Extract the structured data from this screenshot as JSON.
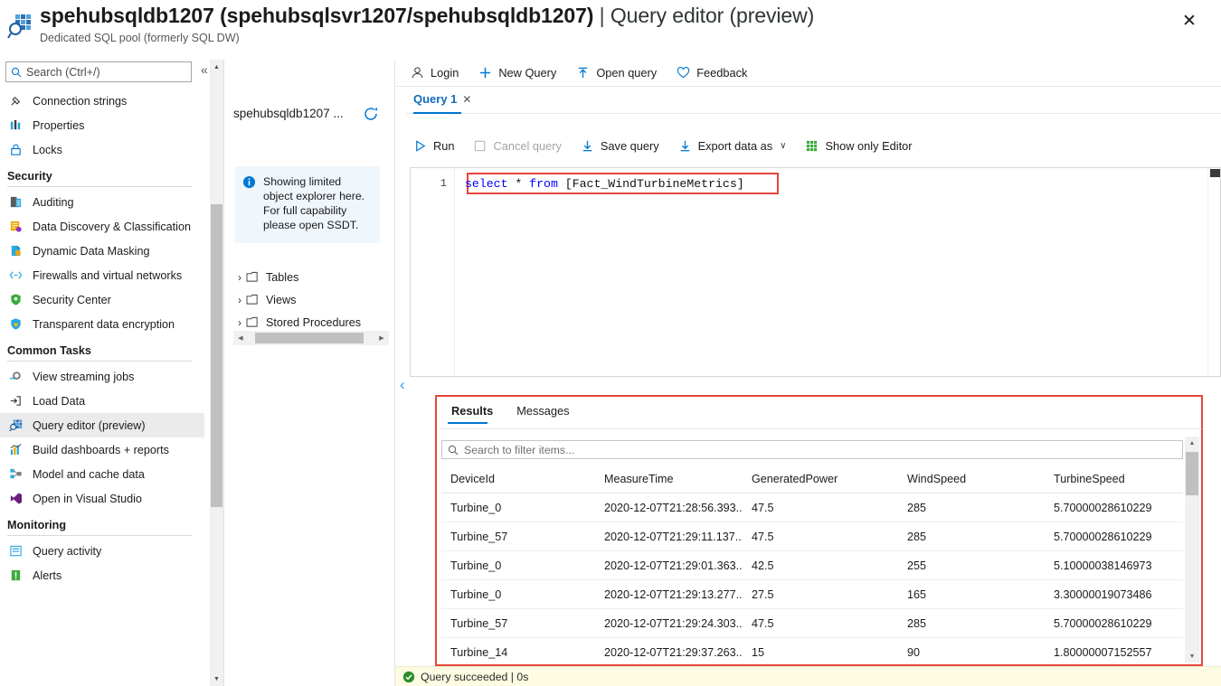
{
  "header": {
    "icon": "query-editor-icon",
    "title_main": "spehubsqldb1207 (spehubsqlsvr1207/spehubsqldb1207)",
    "title_separator": "|",
    "title_suffix": "Query editor (preview)",
    "subtitle": "Dedicated SQL pool (formerly SQL DW)",
    "close_label": "✕"
  },
  "sidebar": {
    "search_placeholder": "Search (Ctrl+/)",
    "search_value": "",
    "collapse_label": "«",
    "items": [
      {
        "label": "Connection strings",
        "icon": "plug-icon",
        "active": false
      },
      {
        "label": "Properties",
        "icon": "properties-icon",
        "active": false
      },
      {
        "label": "Locks",
        "icon": "lock-icon",
        "active": false
      }
    ],
    "section_security": "Security",
    "security_items": [
      {
        "label": "Auditing",
        "icon": "auditing-icon",
        "active": false
      },
      {
        "label": "Data Discovery & Classification",
        "icon": "data-discovery-icon",
        "active": false
      },
      {
        "label": "Dynamic Data Masking",
        "icon": "masking-icon",
        "active": false
      },
      {
        "label": "Firewalls and virtual networks",
        "icon": "firewall-icon",
        "active": false
      },
      {
        "label": "Security Center",
        "icon": "shield-green-icon",
        "active": false
      },
      {
        "label": "Transparent data encryption",
        "icon": "shield-lock-icon",
        "active": false
      }
    ],
    "section_common": "Common Tasks",
    "common_items": [
      {
        "label": "View streaming jobs",
        "icon": "streaming-jobs-icon",
        "active": false
      },
      {
        "label": "Load Data",
        "icon": "load-data-icon",
        "active": false
      },
      {
        "label": "Query editor (preview)",
        "icon": "query-editor-icon",
        "active": true
      },
      {
        "label": "Build dashboards + reports",
        "icon": "dashboard-icon",
        "active": false
      },
      {
        "label": "Model and cache data",
        "icon": "model-cache-icon",
        "active": false
      },
      {
        "label": "Open in Visual Studio",
        "icon": "visual-studio-icon",
        "active": false
      }
    ],
    "section_monitoring": "Monitoring",
    "monitoring_items": [
      {
        "label": "Query activity",
        "icon": "query-activity-icon",
        "active": false
      },
      {
        "label": "Alerts",
        "icon": "alerts-icon",
        "active": false
      }
    ]
  },
  "object_explorer": {
    "db_name": "spehubsqldb1207 ...",
    "refresh_icon": "refresh-icon",
    "info_icon": "info-icon",
    "info_text": "Showing limited object explorer here. For full capability please open SSDT.",
    "tree": [
      {
        "label": "Tables",
        "icon": "folder-icon",
        "expanded": false
      },
      {
        "label": "Views",
        "icon": "folder-icon",
        "expanded": false
      },
      {
        "label": "Stored Procedures",
        "icon": "folder-icon",
        "expanded": false
      }
    ]
  },
  "top_toolbar": [
    {
      "label": "Login",
      "icon": "person-icon"
    },
    {
      "label": "New Query",
      "icon": "plus-icon"
    },
    {
      "label": "Open query",
      "icon": "upload-icon"
    },
    {
      "label": "Feedback",
      "icon": "heart-icon"
    }
  ],
  "query_tab": {
    "label": "Query 1",
    "close_label": "✕"
  },
  "query_toolbar": [
    {
      "label": "Run",
      "icon": "play-icon",
      "disabled": false
    },
    {
      "label": "Cancel query",
      "icon": "stop-icon",
      "disabled": true
    },
    {
      "label": "Save query",
      "icon": "download-icon",
      "disabled": false
    },
    {
      "label": "Export data as",
      "icon": "download-icon",
      "disabled": false,
      "chevron": "∨"
    },
    {
      "label": "Show only Editor",
      "icon": "grid-icon",
      "disabled": false
    }
  ],
  "editor": {
    "line_number": "1",
    "sql_keyword_select": "select",
    "sql_star": " * ",
    "sql_keyword_from": "from",
    "sql_table": " [Fact_WindTurbineMetrics]",
    "collapse_label": "‹"
  },
  "results": {
    "tabs": [
      {
        "label": "Results",
        "active": true
      },
      {
        "label": "Messages",
        "active": false
      }
    ],
    "filter_placeholder": "Search to filter items...",
    "filter_value": "",
    "columns": [
      "DeviceId",
      "MeasureTime",
      "GeneratedPower",
      "WindSpeed",
      "TurbineSpeed"
    ],
    "rows": [
      [
        "Turbine_0",
        "2020-12-07T21:28:56.393...",
        "47.5",
        "285",
        "5.70000028610229"
      ],
      [
        "Turbine_57",
        "2020-12-07T21:29:11.137...",
        "47.5",
        "285",
        "5.70000028610229"
      ],
      [
        "Turbine_0",
        "2020-12-07T21:29:01.363...",
        "42.5",
        "255",
        "5.10000038146973"
      ],
      [
        "Turbine_0",
        "2020-12-07T21:29:13.277...",
        "27.5",
        "165",
        "3.30000019073486"
      ],
      [
        "Turbine_57",
        "2020-12-07T21:29:24.303...",
        "47.5",
        "285",
        "5.70000028610229"
      ],
      [
        "Turbine_14",
        "2020-12-07T21:29:37.263...",
        "15",
        "90",
        "1.80000007152557"
      ]
    ]
  },
  "status": {
    "icon": "success-check-icon",
    "text": "Query succeeded | 0s"
  },
  "colors": {
    "accent": "#0078d4",
    "annotation_red": "#e8453c",
    "status_bg": "#fdfbe2",
    "success_green": "#2a8c2a",
    "info_bg": "#eff6fc"
  }
}
